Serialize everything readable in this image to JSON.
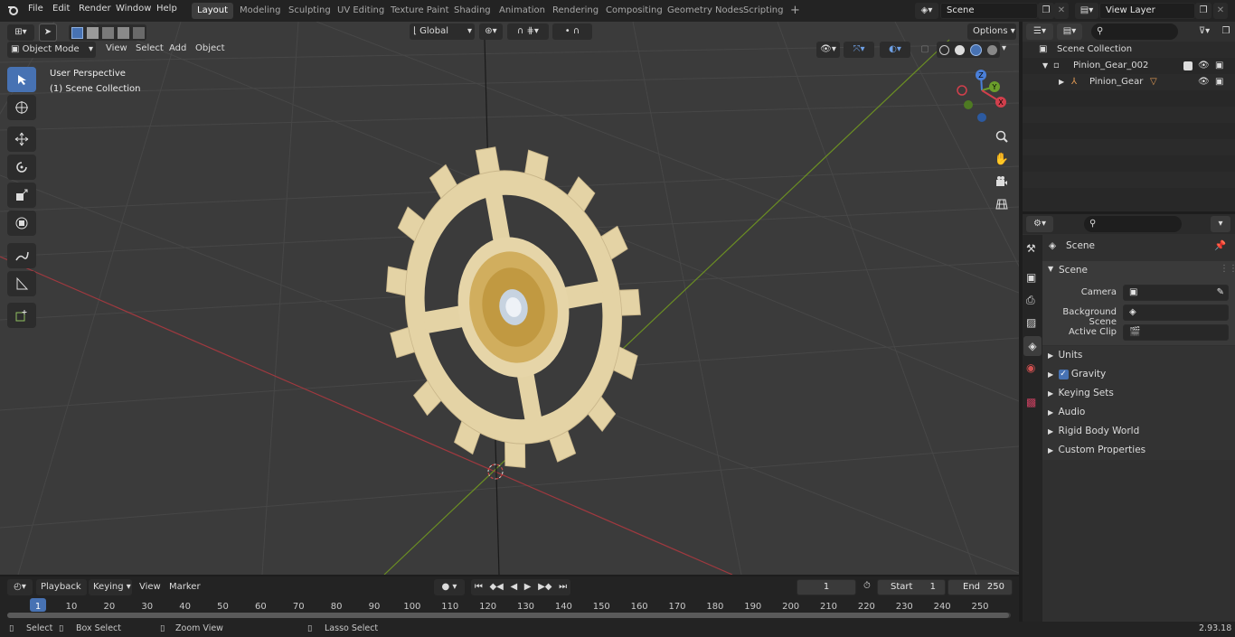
{
  "menubar": {
    "file": "File",
    "edit": "Edit",
    "render": "Render",
    "window": "Window",
    "help": "Help"
  },
  "workspaces": [
    "Layout",
    "Modeling",
    "Sculpting",
    "UV Editing",
    "Texture Paint",
    "Shading",
    "Animation",
    "Rendering",
    "Compositing",
    "Geometry Nodes",
    "Scripting"
  ],
  "scene": {
    "name": "Scene",
    "view_layer": "View Layer"
  },
  "viewport": {
    "mode": "Object Mode",
    "view": "View",
    "select": "Select",
    "add": "Add",
    "object": "Object",
    "orientation": "Global",
    "options": "Options",
    "overlay_line1": "User Perspective",
    "overlay_line2": "(1) Scene Collection",
    "axis_x": "X",
    "axis_y": "Y",
    "axis_z": "Z"
  },
  "outliner": {
    "root": "Scene Collection",
    "item1": "Pinion_Gear_002",
    "item2": "Pinion_Gear"
  },
  "properties": {
    "header": "Scene",
    "section": "Scene",
    "camera_label": "Camera",
    "bg_label": "Background Scene",
    "clip_label": "Active Clip",
    "panels": [
      "Units",
      "Gravity",
      "Keying Sets",
      "Audio",
      "Rigid Body World",
      "Custom Properties"
    ]
  },
  "timeline": {
    "playback": "Playback",
    "keying": "Keying",
    "view": "View",
    "marker": "Marker",
    "current_frame": "1",
    "start_label": "Start",
    "start": "1",
    "end_label": "End",
    "end": "250",
    "ticks": [
      "1",
      "10",
      "20",
      "30",
      "40",
      "50",
      "60",
      "70",
      "80",
      "90",
      "100",
      "110",
      "120",
      "130",
      "140",
      "150",
      "160",
      "170",
      "180",
      "190",
      "200",
      "210",
      "220",
      "230",
      "240",
      "250"
    ]
  },
  "status": {
    "select": "Select",
    "box_select": "Box Select",
    "zoom_view": "Zoom View",
    "lasso_select": "Lasso Select",
    "version": "2.93.18"
  },
  "colors": {
    "accent": "#4772b3",
    "x_axis": "#a0393f",
    "y_axis": "#6b8e23",
    "gear": "#e6d5a8"
  }
}
